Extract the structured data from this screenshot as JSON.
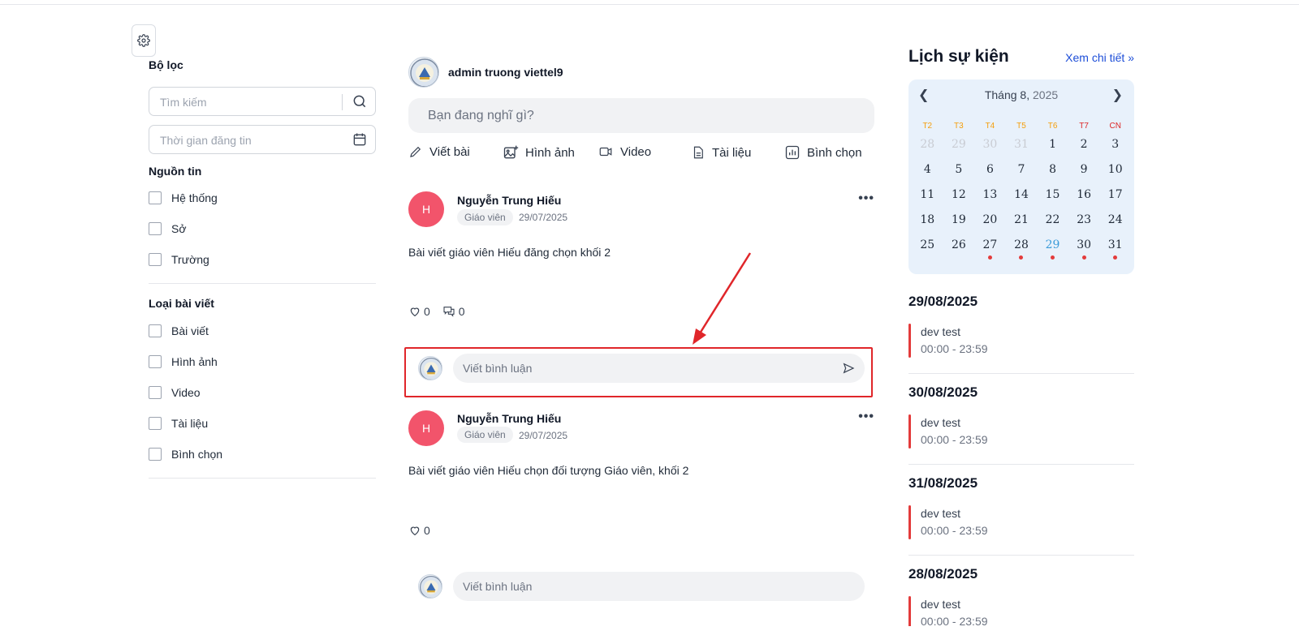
{
  "filter": {
    "title": "Bộ lọc",
    "search_placeholder": "Tìm kiếm",
    "date_placeholder": "Thời gian đăng tin",
    "source_title": "Nguồn tin",
    "sources": [
      "Hệ thống",
      "Sở",
      "Trường"
    ],
    "type_title": "Loại bài viết",
    "types": [
      "Bài viết",
      "Hình ảnh",
      "Video",
      "Tài liệu",
      "Bình chọn"
    ]
  },
  "composer": {
    "user_name": "admin truong viettel9",
    "placeholder": "Bạn đang nghĩ gì?",
    "actions": [
      "Viết bài",
      "Hình ảnh",
      "Video",
      "Tài liệu",
      "Bình chọn"
    ]
  },
  "posts": [
    {
      "avatar_letter": "H",
      "author": "Nguyễn Trung Hiếu",
      "role": "Giáo viên",
      "date": "29/07/2025",
      "body": "Bài viết giáo viên Hiếu đăng chọn khối 2",
      "likes": "0",
      "comments": "0",
      "comment_placeholder": "Viết bình luận"
    },
    {
      "avatar_letter": "H",
      "author": "Nguyễn Trung Hiếu",
      "role": "Giáo viên",
      "date": "29/07/2025",
      "body": "Bài viết giáo viên Hiếu chọn đối tượng Giáo viên, khối 2",
      "likes": "0",
      "comment_placeholder": "Viết bình luận"
    }
  ],
  "events": {
    "title": "Lịch sự kiện",
    "more_link": "Xem chi tiết »",
    "calendar": {
      "month_label": "Tháng 8,",
      "year_label": "2025",
      "weekdays": [
        "T2",
        "T3",
        "T4",
        "T5",
        "T6",
        "T7",
        "CN"
      ],
      "days": [
        {
          "d": "28",
          "muted": true
        },
        {
          "d": "29",
          "muted": true
        },
        {
          "d": "30",
          "muted": true
        },
        {
          "d": "31",
          "muted": true
        },
        {
          "d": "1"
        },
        {
          "d": "2"
        },
        {
          "d": "3"
        },
        {
          "d": "4"
        },
        {
          "d": "5"
        },
        {
          "d": "6"
        },
        {
          "d": "7"
        },
        {
          "d": "8"
        },
        {
          "d": "9"
        },
        {
          "d": "10"
        },
        {
          "d": "11"
        },
        {
          "d": "12"
        },
        {
          "d": "13"
        },
        {
          "d": "14"
        },
        {
          "d": "15"
        },
        {
          "d": "16"
        },
        {
          "d": "17"
        },
        {
          "d": "18"
        },
        {
          "d": "19"
        },
        {
          "d": "20"
        },
        {
          "d": "21"
        },
        {
          "d": "22"
        },
        {
          "d": "23"
        },
        {
          "d": "24"
        },
        {
          "d": "25"
        },
        {
          "d": "26"
        },
        {
          "d": "27",
          "event": true
        },
        {
          "d": "28",
          "event": true
        },
        {
          "d": "29",
          "today": true,
          "event": true
        },
        {
          "d": "30",
          "event": true
        },
        {
          "d": "31",
          "event": true
        }
      ]
    },
    "list": [
      {
        "date": "29/08/2025",
        "name": "dev test",
        "time": "00:00 - 23:59"
      },
      {
        "date": "30/08/2025",
        "name": "dev test",
        "time": "00:00 - 23:59"
      },
      {
        "date": "31/08/2025",
        "name": "dev test",
        "time": "00:00 - 23:59"
      },
      {
        "date": "28/08/2025",
        "name": "dev test",
        "time": "00:00 - 23:59"
      }
    ]
  },
  "colors": {
    "accent_red": "#e0262a",
    "avatar_pink": "#f2546b",
    "link_blue": "#1d4ed8",
    "calendar_bg": "#e8f1fb"
  }
}
